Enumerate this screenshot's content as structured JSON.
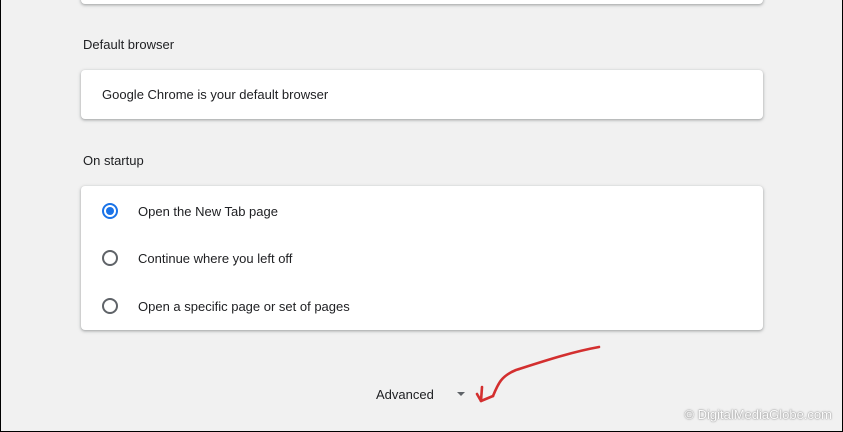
{
  "sections": {
    "default_browser": {
      "title": "Default browser",
      "status": "Google Chrome is your default browser"
    },
    "on_startup": {
      "title": "On startup",
      "options": [
        {
          "label": "Open the New Tab page",
          "checked": true
        },
        {
          "label": "Continue where you left off",
          "checked": false
        },
        {
          "label": "Open a specific page or set of pages",
          "checked": false
        }
      ]
    }
  },
  "advanced": {
    "label": "Advanced",
    "icon": "caret-down-icon"
  },
  "annotation": {
    "color": "#d32f2f",
    "icon": "red-arrow-annotation"
  },
  "watermark": "© DigitalMediaGlobe.com",
  "colors": {
    "accent": "#1a73e8",
    "background": "#f1f1f1",
    "card": "#ffffff"
  }
}
